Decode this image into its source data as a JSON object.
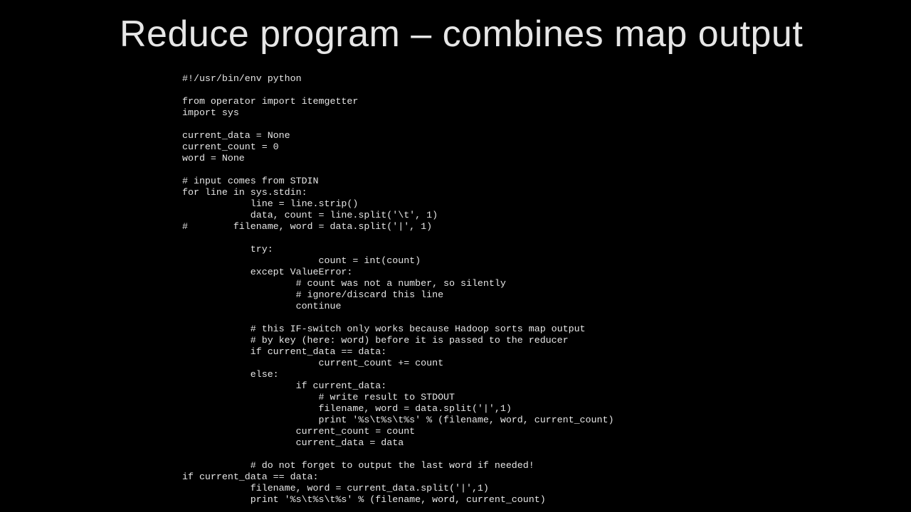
{
  "title": "Reduce program – combines map output",
  "code": "#!/usr/bin/env python\n\nfrom operator import itemgetter\nimport sys\n\ncurrent_data = None\ncurrent_count = 0\nword = None\n\n# input comes from STDIN\nfor line in sys.stdin:\n            line = line.strip()\n            data, count = line.split('\\t', 1)\n#        filename, word = data.split('|', 1)\n\n            try:\n                        count = int(count)\n            except ValueError:\n                    # count was not a number, so silently\n                    # ignore/discard this line\n                    continue\n\n            # this IF-switch only works because Hadoop sorts map output\n            # by key (here: word) before it is passed to the reducer\n            if current_data == data:\n                        current_count += count\n            else:\n                    if current_data:\n                        # write result to STDOUT\n                        filename, word = data.split('|',1)\n                        print '%s\\t%s\\t%s' % (filename, word, current_count)\n                    current_count = count\n                    current_data = data\n\n            # do not forget to output the last word if needed!\nif current_data == data:\n            filename, word = current_data.split('|',1)\n            print '%s\\t%s\\t%s' % (filename, word, current_count)"
}
